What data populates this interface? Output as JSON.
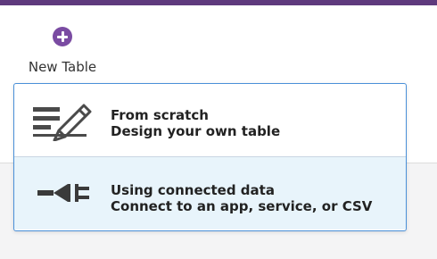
{
  "toolbar": {
    "new_table_label": "New Table",
    "new_table_icon": "plus-circle-icon"
  },
  "menu": {
    "items": [
      {
        "title": "From scratch",
        "subtitle": "Design your own table",
        "icon": "pencil-lines-icon"
      },
      {
        "title": "Using connected data",
        "subtitle": "Connect to an app, service, or CSV",
        "icon": "plug-icon"
      }
    ]
  },
  "colors": {
    "header_bar": "#5f3a7d",
    "accent": "#7a4ba2",
    "dropdown_border": "#4a90d9",
    "hover_background": "#e8f4fb"
  }
}
